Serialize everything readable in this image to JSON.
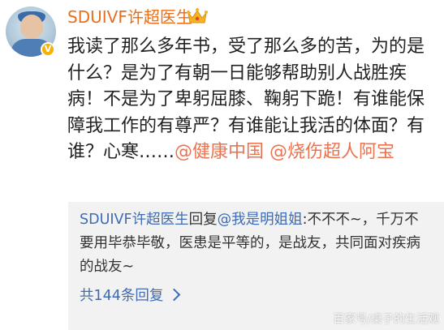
{
  "post": {
    "username": "SDUIVF许超医生",
    "avatar_icon": "doctor-avatar",
    "verified_badge": "V",
    "crown_icon": "crown-icon",
    "text_before": "我读了那么多年书，受了那么多的苦，为的是什么？是为了有朝一日能够帮助别人战胜疾病！不是为了卑躬屈膝、鞠躬下跪！有谁能保障我工作的有尊严？有谁能让我活的体面？有谁？心寒……",
    "mention_1": "@健康中国",
    "mention_2": "@烧伤超人阿宝"
  },
  "reply": {
    "author": "SDUIVF许超医生",
    "action": "回复",
    "target": "@我是明姐姐",
    "text": ":不不不~，千万不要用毕恭毕敬，医患是平等的，是战友，共同面对疾病的战友~",
    "more_label": "共144条回复"
  },
  "watermark": "百家号/桌子的生活观",
  "colors": {
    "username": "#e86f1b",
    "mention": "#eb7350",
    "reply_link": "#3e6bb5",
    "reply_bg": "#f2f2f2",
    "badge": "#f5b200"
  }
}
